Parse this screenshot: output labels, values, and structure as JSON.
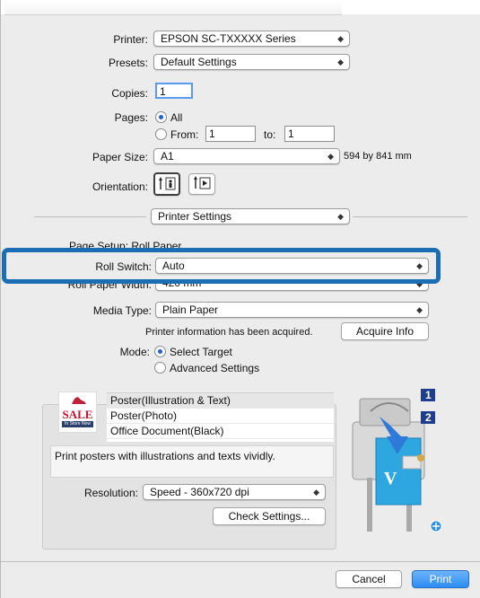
{
  "printer": {
    "label": "Printer:",
    "value": "EPSON SC-TXXXXX Series"
  },
  "presets": {
    "label": "Presets:",
    "value": "Default Settings"
  },
  "copies": {
    "label": "Copies:",
    "value": "1"
  },
  "pages": {
    "label": "Pages:",
    "all": "All",
    "from": "From:",
    "from_value": "1",
    "to": "to:",
    "to_value": "1"
  },
  "paper_size": {
    "label": "Paper Size:",
    "value": "A1",
    "dims": "594 by 841 mm"
  },
  "orientation": {
    "label": "Orientation:"
  },
  "section": {
    "value": "Printer Settings"
  },
  "page_setup": {
    "text": "Page Setup: Roll Paper"
  },
  "roll_switch": {
    "label": "Roll Switch:",
    "value": "Auto"
  },
  "roll_width": {
    "label": "Roll Paper Width:",
    "value": "420 mm"
  },
  "media_type": {
    "label": "Media Type:",
    "value": "Plain Paper"
  },
  "printer_info": {
    "text": "Printer information has been acquired.",
    "button": "Acquire Info"
  },
  "mode": {
    "label": "Mode:",
    "select_target": "Select Target",
    "advanced": "Advanced Settings"
  },
  "targets": [
    "Poster(Illustration & Text)",
    "Poster(Photo)",
    "Office Document(Black)"
  ],
  "sale_icon": {
    "sale": "SALE",
    "instore": "In Store Now"
  },
  "description": "Print posters with illustrations and texts vividly.",
  "resolution": {
    "label": "Resolution:",
    "value": "Speed - 360x720 dpi"
  },
  "check_settings": "Check Settings...",
  "badges": {
    "one": "1",
    "two": "2",
    "v": "V"
  },
  "buttons": {
    "cancel": "Cancel",
    "print": "Print"
  },
  "colors": {
    "highlight": "#1b6db4",
    "accent": "#2c8df3"
  }
}
